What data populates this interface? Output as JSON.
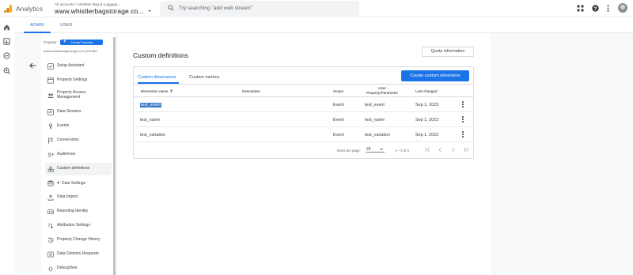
{
  "topbar": {
    "app_name": "Analytics",
    "breadcrumb": "All accounts > Whistler Bag & Luggage...",
    "account_name": "www.whistlerbagstorage.co...",
    "search_placeholder": "Try searching \"add web stream\""
  },
  "admin_tabs": [
    {
      "label": "ADMIN",
      "active": true
    },
    {
      "label": "USER",
      "active": false
    }
  ],
  "nav": {
    "property_label": "Property",
    "create_property_label": "Create Property",
    "property_id": "www.whistlerbagstorage.com (311884...",
    "items": [
      {
        "label": "Setup Assistant",
        "icon": "checklist-icon"
      },
      {
        "label": "Property Settings",
        "icon": "settings-window-icon"
      },
      {
        "label": "Property Access Management",
        "icon": "people-icon"
      },
      {
        "label": "Data Streams",
        "icon": "data-streams-icon"
      },
      {
        "label": "Events",
        "icon": "touch-icon"
      },
      {
        "label": "Conversions",
        "icon": "flag-icon"
      },
      {
        "label": "Audiences",
        "icon": "audience-icon"
      },
      {
        "label": "Custom definitions",
        "icon": "shapes-icon",
        "selected": true
      },
      {
        "label": "Data Settings",
        "icon": "database-icon"
      },
      {
        "label": "Data Import",
        "icon": "upload-icon"
      },
      {
        "label": "Reporting Identity",
        "icon": "id-icon"
      },
      {
        "label": "Attribution Settings",
        "icon": "attribution-icon"
      },
      {
        "label": "Property Change History",
        "icon": "history-icon"
      },
      {
        "label": "Data Deletion Requests",
        "icon": "delete-data-icon"
      },
      {
        "label": "DebugView",
        "icon": "bug-icon"
      }
    ]
  },
  "main": {
    "title": "Custom definitions",
    "quota_button": "Quota information",
    "tabs": [
      {
        "label": "Custom dimensions",
        "active": true
      },
      {
        "label": "Custom metrics",
        "active": false
      }
    ],
    "create_button": "Create custom dimension",
    "columns": {
      "dimension_name": "Dimension name",
      "sort_icon": "arrow-up-icon",
      "description": "Description",
      "scope": "Scope",
      "user_property_line1": "User",
      "user_property_line2": "Property/Parameter",
      "last_changed": "Last changed"
    },
    "rows": [
      {
        "name": "test_event",
        "description": "",
        "scope": "Event",
        "parameter": "test_event",
        "last_changed": "Sep 1, 2023",
        "highlighted": true
      },
      {
        "name": "test_name",
        "description": "",
        "scope": "Event",
        "parameter": "test_name",
        "last_changed": "Sep 1, 2023",
        "highlighted": false
      },
      {
        "name": "test_variation",
        "description": "",
        "scope": "Event",
        "parameter": "test_variation",
        "last_changed": "Sep 1, 2023",
        "highlighted": false
      }
    ],
    "pagination": {
      "items_per_page_label": "Items per page:",
      "items_per_page_value": "25",
      "range": "1 – 3 of 3"
    }
  },
  "colors": {
    "accent": "#1a73e8",
    "selection": "#3a74c9",
    "logo_orange": "#f9ab00",
    "logo_dark_orange": "#e37400"
  }
}
